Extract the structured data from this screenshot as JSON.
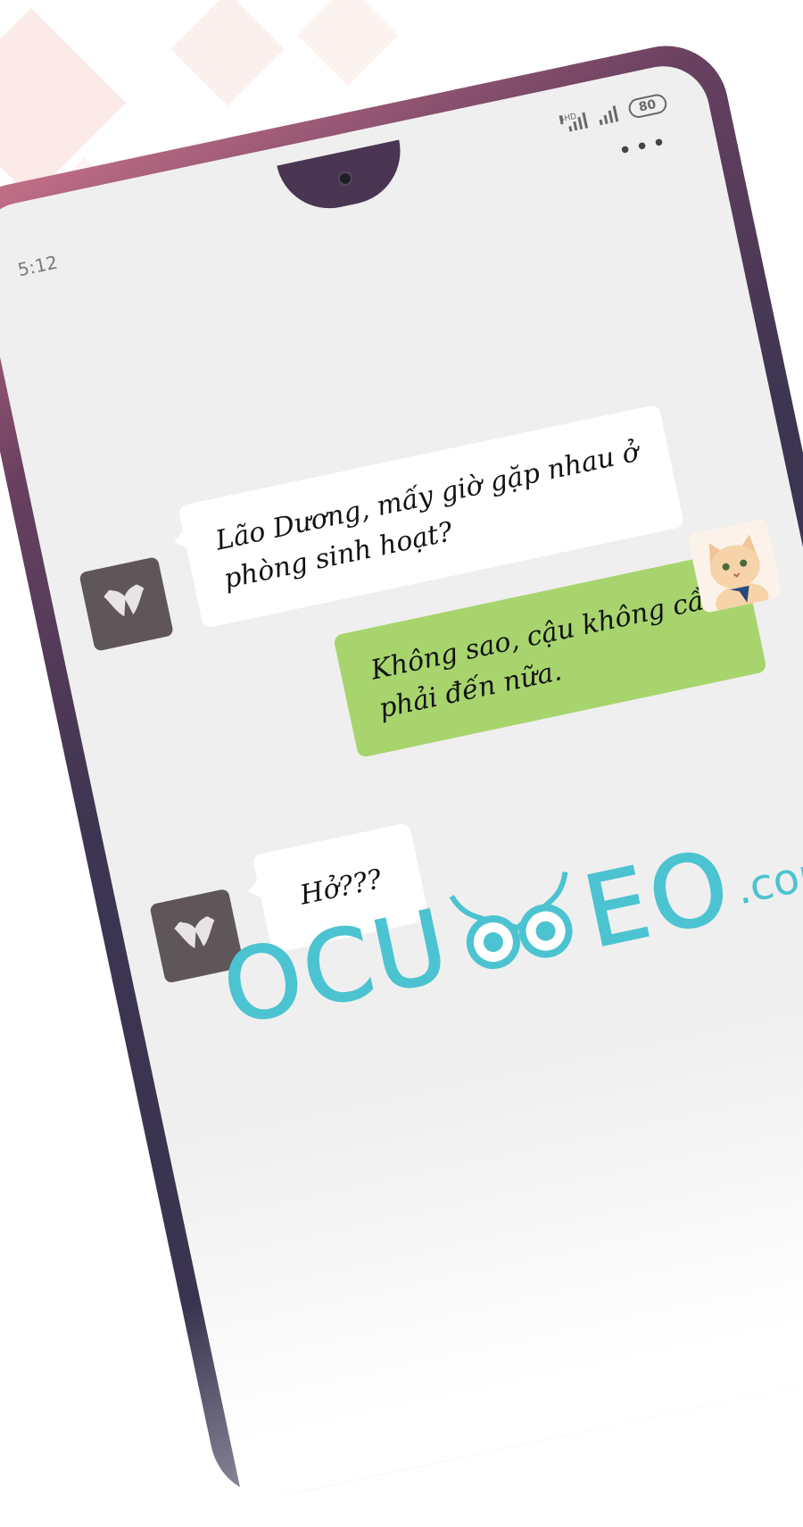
{
  "status_bar": {
    "time": "5:12",
    "network_label": "4HD",
    "battery": "80",
    "more_icon": "more-dots-icon"
  },
  "chat": {
    "messages": [
      {
        "side": "left",
        "avatar": "mustache-avatar-icon",
        "text": "Lão Dương, mấy giờ gặp nhau ở\nphòng sinh hoạt?"
      },
      {
        "side": "right",
        "avatar": "cat-avatar",
        "text": "Không sao, cậu không cần\nphải đến nữa."
      },
      {
        "side": "left",
        "avatar": "mustache-avatar-icon",
        "text": "Hở???"
      }
    ]
  },
  "watermark": {
    "left_text": "OCU",
    "right_text": "EO",
    "suffix": ".com",
    "color": "#4cc3d1"
  },
  "colors": {
    "screen_bg": "#efefef",
    "sent_bubble": "#a8d46e",
    "received_bubble": "#ffffff",
    "frame": "#3d3552"
  }
}
